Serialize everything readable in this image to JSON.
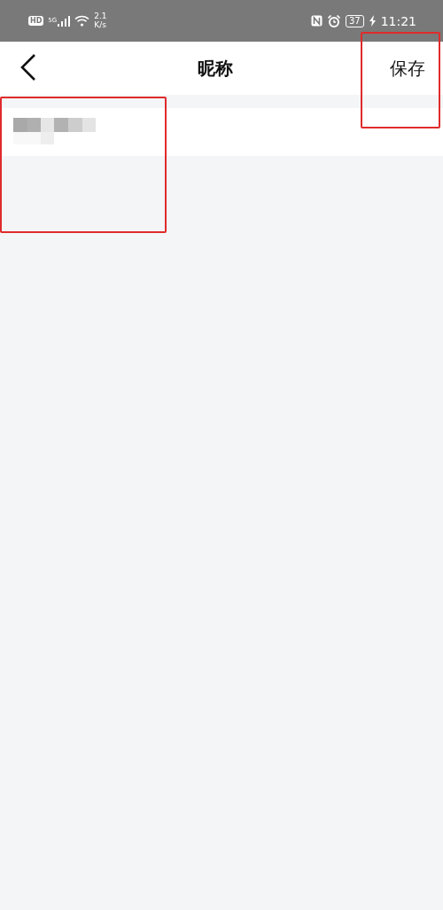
{
  "status_bar": {
    "hd": "HD",
    "network": "5G",
    "speed_value": "2.1",
    "speed_unit": "K/s",
    "battery": "37",
    "charging": true,
    "time": "11:21"
  },
  "nav": {
    "title": "昵称",
    "save": "保存",
    "save_highlighted": true
  },
  "name_field": {
    "kind": "pixelated",
    "highlighted": true
  }
}
